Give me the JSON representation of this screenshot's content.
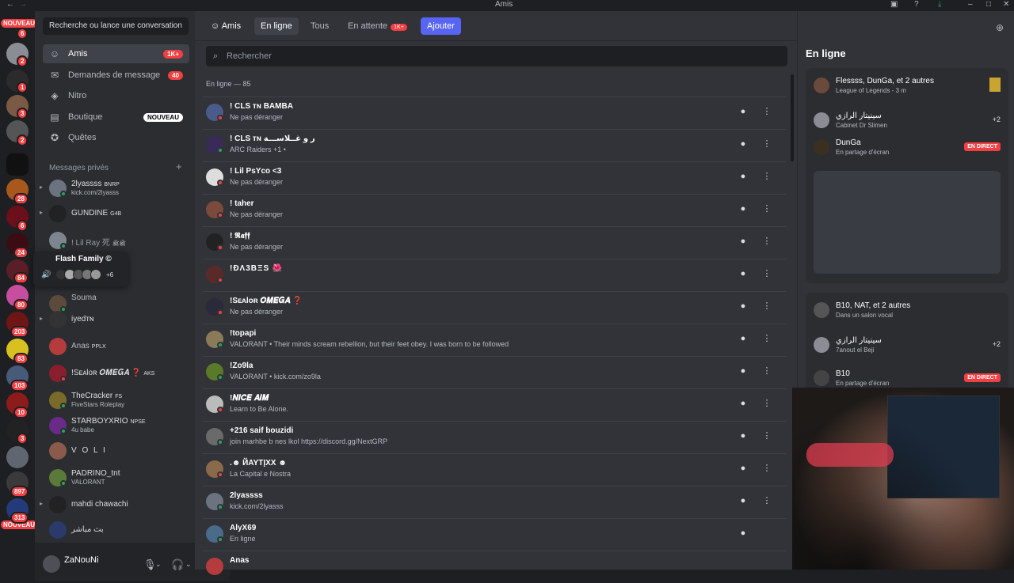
{
  "titlebar": {
    "title": "Amis"
  },
  "rail": {
    "nouveau_top": "NOUVEAU",
    "nouveau_bottom": "NOUVEAU",
    "badges": [
      "6",
      "2",
      "1",
      "3",
      "2",
      "28",
      "6",
      "24",
      "84",
      "80",
      "203",
      "83",
      "103",
      "10",
      "3",
      "897",
      "313"
    ]
  },
  "sidebar": {
    "search_label": "Recherche ou lance une conversation",
    "nav": [
      {
        "label": "Amis",
        "badge": "1K+"
      },
      {
        "label": "Demandes de message",
        "badge": "40"
      },
      {
        "label": "Nitro",
        "badge": ""
      },
      {
        "label": "Boutique",
        "badge": "NOUVEAU"
      },
      {
        "label": "Quêtes",
        "badge": ""
      }
    ],
    "section_label": "Messages privés",
    "dms": [
      {
        "name": "2lyassss",
        "tag": "BNRP",
        "sub": "kick.com/2lyasss"
      },
      {
        "name": "GUNDINE",
        "tag": "G4B",
        "sub": ""
      },
      {
        "name": "! Lil Ray 死",
        "tag": "ﷺﷺ",
        "sub": ""
      },
      {
        "name": "Souma",
        "tag": "",
        "sub": ""
      },
      {
        "name": "iyedᴛɴ",
        "tag": "",
        "sub": ""
      },
      {
        "name": "Anas",
        "tag": "PPLX",
        "sub": ""
      },
      {
        "name": "!Sᴇᴀlᴏʀ 𝑶𝑴𝑬𝑮𝑨 ❓",
        "tag": "AKS",
        "sub": ""
      },
      {
        "name": "TheCracker",
        "tag": "FS",
        "sub": "FiveStars Roleplay"
      },
      {
        "name": "STARBOYXRIO",
        "tag": "NPSE",
        "sub": "4u babe"
      },
      {
        "name": "V O L I",
        "tag": "",
        "sub": ""
      },
      {
        "name": "PADRINO_tnt",
        "tag": "",
        "sub": "VALORANT"
      },
      {
        "name": "mahdi chawachi",
        "tag": "",
        "sub": ""
      },
      {
        "name": "بث مباشر",
        "tag": "",
        "sub": ""
      }
    ],
    "voice_popup": {
      "title": "Flash Family ©",
      "more": "+6"
    },
    "user": {
      "name": "ZaNouNi"
    }
  },
  "main": {
    "tabs": [
      {
        "label": "Amis"
      },
      {
        "label": "En ligne"
      },
      {
        "label": "Tous"
      },
      {
        "label": "En attente",
        "badge": "1K+"
      },
      {
        "label": "Ajouter"
      }
    ],
    "search_placeholder": "Rechercher",
    "online_count": "En ligne — 85",
    "friends": [
      {
        "name": "! CLS ᴛɴ BAMBA",
        "sub": "Ne pas déranger"
      },
      {
        "name": "! CLS ᴛɴ ﺭ ﻭ ﻏــﻼﺳـــﺔ",
        "sub": "ARC Raiders +1 •"
      },
      {
        "name": "! Lil PsYco <3",
        "sub": "Ne pas déranger"
      },
      {
        "name": "! taher",
        "sub": "Ne pas déranger"
      },
      {
        "name": "! 𝕽𝖆𝖋𝖋",
        "sub": "Ne pas déranger"
      },
      {
        "name": "!ĐΛ3BΞS 🌺",
        "sub": ""
      },
      {
        "name": "!Sᴇᴀlᴏʀ 𝑶𝑴𝑬𝑮𝑨 ❓",
        "sub": "Ne pas déranger"
      },
      {
        "name": "!topapi",
        "sub": "VALORANT • Their minds scream rebellion, but their feet obey. I was born to be followed"
      },
      {
        "name": "!Zo9la",
        "sub": "VALORANT • kick.com/zo9la"
      },
      {
        "name": "!𝑵𝑰𝑪𝑬 𝑨𝑰𝑴",
        "sub": "Learn to Be Alone."
      },
      {
        "name": "+216 saif bouzidi",
        "sub": "join marhbe b nes lkol https://discord.gg/NextGRP"
      },
      {
        "name": ".☻ ЙAYTĮXX ☻",
        "sub": "La Capital e Nostra"
      },
      {
        "name": "2lyassss",
        "sub": "kick.com/2lyasss"
      },
      {
        "name": "AlyX69",
        "sub": "En ligne"
      },
      {
        "name": "Anas",
        "sub": ""
      }
    ]
  },
  "right": {
    "heading": "En ligne",
    "card1": {
      "title": "Flessss, DunGa, et 2 autres",
      "subtitle": "League of Legends - 3 m",
      "row1_name": "سينيتار الرازي",
      "row1_sub": "Cabinet Dr Slimen",
      "row1_plus": "+2",
      "row2_name": "DunGa",
      "row2_sub": "En partage d'écran",
      "live": "EN DIRECT"
    },
    "card2": {
      "title": "B10, NAT, et 2 autres",
      "subtitle": "Dans un salon vocal",
      "row1_name": "سينيتار الرازي",
      "row1_sub": "7anout el Beji",
      "row1_plus": "+2",
      "row2_name": "B10",
      "row2_sub": "En partage d'écran",
      "live": "EN DIRECT"
    }
  }
}
